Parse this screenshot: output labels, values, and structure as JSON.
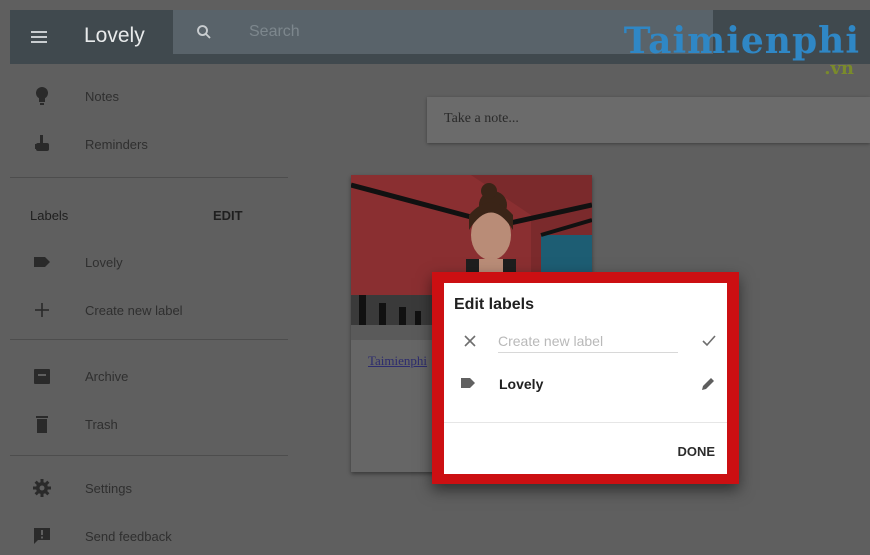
{
  "header": {
    "title": "Lovely",
    "search_placeholder": "Search"
  },
  "watermark": {
    "main": "Taimienphi",
    "sub": ".vn"
  },
  "sidebar": {
    "items": [
      {
        "label": "Notes",
        "icon": "lightbulb-icon"
      },
      {
        "label": "Reminders",
        "icon": "reminder-hand-icon"
      },
      {
        "label": "Lovely",
        "icon": "label-tag-icon"
      },
      {
        "label": "Create new label",
        "icon": "plus-icon"
      },
      {
        "label": "Archive",
        "icon": "archive-icon"
      },
      {
        "label": "Trash",
        "icon": "trash-icon"
      },
      {
        "label": "Settings",
        "icon": "gear-icon"
      },
      {
        "label": "Send feedback",
        "icon": "feedback-icon"
      }
    ],
    "labels_header": "Labels",
    "edit_label": "EDIT"
  },
  "main": {
    "take_note_placeholder": "Take a note...",
    "note_card": {
      "link_text": "Taimienphi"
    }
  },
  "dialog": {
    "title": "Edit labels",
    "new_label_placeholder": "Create new label",
    "labels": [
      {
        "name": "Lovely"
      }
    ],
    "done_label": "DONE"
  },
  "colors": {
    "topbar": "#40494e",
    "searchbox": "#59636a",
    "overlay_background": "#5f5f5f",
    "highlight_frame": "#cc0f12",
    "watermark_blue": "#2f87c5",
    "watermark_green": "#7a8b2b"
  }
}
